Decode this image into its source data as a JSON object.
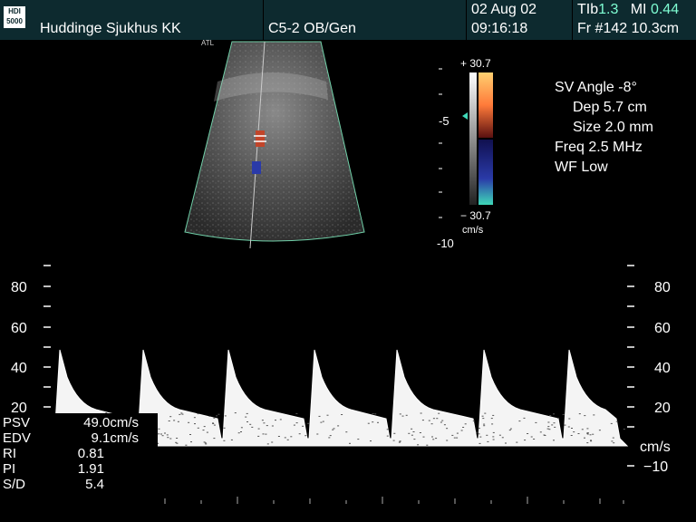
{
  "header": {
    "logo": "HDI 5000",
    "hospital": "Huddinge Sjukhus KK",
    "probe": "C5-2 OB/Gen",
    "date": "02 Aug 02",
    "time": "09:16:18",
    "tib_label": "TIb",
    "tib_value": "1.3",
    "mi_label": "MI",
    "mi_value": "0.44",
    "frame": "Fr #142",
    "depth": "10.3cm"
  },
  "image": {
    "watermark": "ATL",
    "depth_marks": [
      "-5",
      "-10"
    ]
  },
  "colorbar": {
    "top": "+ 30.7",
    "bottom": "− 30.7",
    "unit": "cm/s",
    "colors": {
      "positive": "#ff7a3a",
      "negative": "#2a3aa8",
      "accent": "#3fd8b8"
    }
  },
  "params": {
    "sv_angle": "SV Angle -8°",
    "dep": "Dep 5.7  cm",
    "size": "Size 2.0  mm",
    "freq": "Freq 2.5  MHz",
    "wf": "WF Low"
  },
  "spectrum": {
    "scale_left": [
      "80",
      "60",
      "40",
      "20"
    ],
    "scale_right": [
      "80",
      "60",
      "40",
      "20"
    ],
    "unit": "cm/s",
    "neg_label": "−10"
  },
  "measurements": [
    {
      "label": "PSV",
      "value": "49.0cm/s"
    },
    {
      "label": "EDV",
      "value": "9.1cm/s"
    },
    {
      "label": "RI",
      "value": "0.81"
    },
    {
      "label": "PI",
      "value": "1.91"
    },
    {
      "label": "S/D",
      "value": "5.4"
    }
  ]
}
